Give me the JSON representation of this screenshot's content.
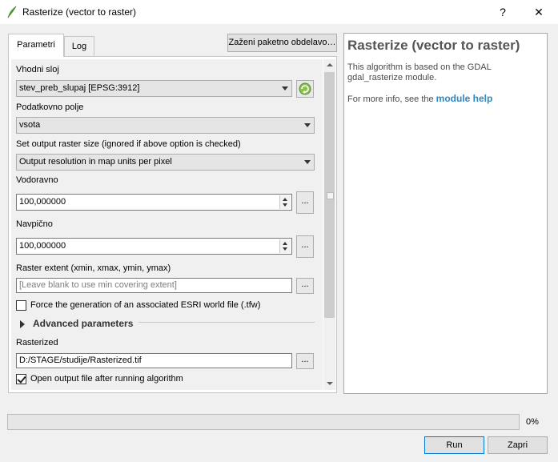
{
  "window": {
    "title": "Rasterize (vector to raster)",
    "help_glyph": "?",
    "close_glyph": "✕"
  },
  "tabs": [
    {
      "label": "Parametri"
    },
    {
      "label": "Log"
    }
  ],
  "batch_button_label": "Zaženi paketno obdelavo…",
  "params": {
    "input_layer": {
      "label": "Vhodni sloj",
      "value": "stev_preb_slupaj [EPSG:3912]"
    },
    "attribute_field": {
      "label": "Podatkovno polje",
      "value": "vsota"
    },
    "output_size": {
      "label": "Set output raster size (ignored if above option is checked)",
      "value": "Output resolution in map units per pixel"
    },
    "horizontal": {
      "label": "Vodoravno",
      "value": "100,000000"
    },
    "vertical": {
      "label": "Navpično",
      "value": "100,000000"
    },
    "extent": {
      "label": "Raster extent (xmin, xmax, ymin, ymax)",
      "placeholder": "[Leave blank to use min covering extent]"
    },
    "world_file": {
      "label": "Force the generation of an associated ESRI world file (.tfw)",
      "checked": false
    },
    "advanced": {
      "label": "Advanced parameters"
    },
    "rasterized": {
      "label": "Rasterized",
      "value": "D:/STAGE/studije/Rasterized.tif"
    },
    "open_output": {
      "label": "Open output file after running algorithm",
      "checked": true
    },
    "dots_label": "..."
  },
  "help": {
    "title": "Rasterize (vector to raster)",
    "description": "This algorithm is based on the GDAL gdal_rasterize module.",
    "more_prefix": "For more info, see the ",
    "more_link": "module help"
  },
  "progress": {
    "value": 0,
    "text": "0%"
  },
  "buttons": {
    "run": "Run",
    "close": "Zapri"
  },
  "colors": {
    "link": "#2f86c4",
    "run_border": "#0078d7",
    "icon_green": "#6aa84f"
  }
}
